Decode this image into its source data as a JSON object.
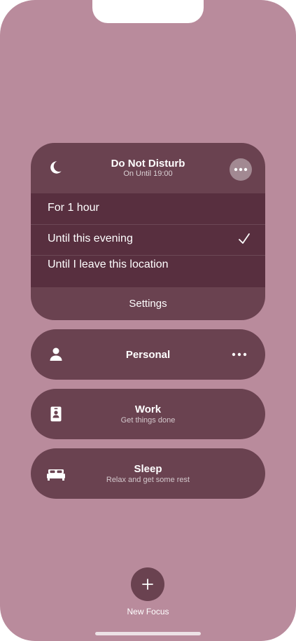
{
  "focus": {
    "dnd": {
      "title": "Do Not Disturb",
      "subtitle": "On Until 19:00",
      "options": [
        {
          "label": "For 1 hour",
          "selected": false
        },
        {
          "label": "Until this evening",
          "selected": true
        },
        {
          "label": "Until I leave this location",
          "selected": false
        }
      ],
      "settings_label": "Settings",
      "icon": "moon-icon"
    },
    "modes": [
      {
        "title": "Personal",
        "subtitle": "",
        "icon": "person-icon"
      },
      {
        "title": "Work",
        "subtitle": "Get things done",
        "icon": "id-badge-icon"
      },
      {
        "title": "Sleep",
        "subtitle": "Relax and get some rest",
        "icon": "bed-icon"
      }
    ],
    "new_focus_label": "New Focus"
  },
  "colors": {
    "background": "#b98b9c",
    "card": "#6a4250",
    "options_panel": "#582f3f"
  }
}
